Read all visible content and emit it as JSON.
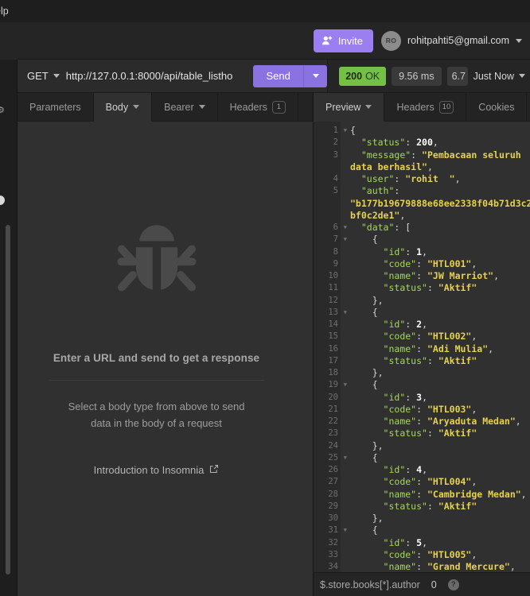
{
  "menubar": {
    "help_label": "elp"
  },
  "account_bar": {
    "invite_label": "Invite",
    "invite_icon": "user-plus-icon",
    "avatar_initials": "RO",
    "email": "rohitpahti5@gmail.com",
    "caret_icon": "chevron-down-icon",
    "accent_color": "#9b7ff0"
  },
  "request_bar": {
    "method": "GET",
    "method_caret_icon": "chevron-down-icon",
    "url": "http://127.0.0.1:8000/api/table_listho",
    "send_label": "Send",
    "send_caret_icon": "chevron-down-icon",
    "send_color": "#8a72e0"
  },
  "response_meta": {
    "status_code": "200",
    "status_text": "OK",
    "status_color": "#74c047",
    "time": "9.56 ms",
    "size": "6.7",
    "timestamp": "Just Now",
    "timestamp_caret_icon": "chevron-down-icon"
  },
  "request_tabs": [
    {
      "label": "Parameters",
      "active": false,
      "caret": false,
      "count": null
    },
    {
      "label": "Body",
      "active": true,
      "caret": true,
      "count": null
    },
    {
      "label": "Bearer",
      "active": false,
      "caret": true,
      "count": null
    },
    {
      "label": "Headers",
      "active": false,
      "caret": false,
      "count": "1"
    }
  ],
  "response_tabs": [
    {
      "label": "Preview",
      "active": true,
      "caret": true,
      "count": null
    },
    {
      "label": "Headers",
      "active": false,
      "caret": false,
      "count": "10"
    },
    {
      "label": "Cookies",
      "active": false,
      "caret": false,
      "count": null
    }
  ],
  "request_empty_state": {
    "icon": "bug-icon",
    "title": "Enter a URL and send to get a response",
    "subtitle": "Select a body type from above to send\ndata in the body of a request",
    "link_label": "Introduction to Insomnia",
    "link_icon": "external-link-icon"
  },
  "filter_bar": {
    "placeholder": "$.store.books[*].author",
    "count": "0",
    "help_icon": "question-mark-icon"
  },
  "response_body": {
    "lines": [
      {
        "num": "1",
        "fold": true,
        "html": "<span class=\"p\">{</span>"
      },
      {
        "num": "2",
        "fold": false,
        "html": "  <span class=\"k\">\"status\"</span><span class=\"p\">:</span> <span class=\"n\">200</span><span class=\"p\">,</span>"
      },
      {
        "num": "3",
        "fold": false,
        "html": "  <span class=\"k\">\"message\"</span><span class=\"p\">:</span> <span class=\"s\">\"Pembacaan seluruh</span>"
      },
      {
        "num": "",
        "fold": false,
        "html": "<span class=\"s\">data berhasil\"</span><span class=\"p\">,</span>"
      },
      {
        "num": "4",
        "fold": false,
        "html": "  <span class=\"k\">\"user\"</span><span class=\"p\">:</span> <span class=\"s\">\"rohit  \"</span><span class=\"p\">,</span>"
      },
      {
        "num": "5",
        "fold": false,
        "html": "  <span class=\"k\">\"auth\"</span><span class=\"p\">:</span>"
      },
      {
        "num": "",
        "fold": false,
        "html": "<span class=\"s\">\"b177b19679888e68ee2338f04b71d3c2</span>"
      },
      {
        "num": "",
        "fold": false,
        "html": "<span class=\"s\">bf0c2de1\"</span><span class=\"p\">,</span>"
      },
      {
        "num": "6",
        "fold": true,
        "html": "  <span class=\"k\">\"data\"</span><span class=\"p\">: [</span>"
      },
      {
        "num": "7",
        "fold": true,
        "html": "    <span class=\"p\">{</span>"
      },
      {
        "num": "8",
        "fold": false,
        "html": "      <span class=\"k\">\"id\"</span><span class=\"p\">:</span> <span class=\"n\">1</span><span class=\"p\">,</span>"
      },
      {
        "num": "9",
        "fold": false,
        "html": "      <span class=\"k\">\"code\"</span><span class=\"p\">:</span> <span class=\"s\">\"HTL001\"</span><span class=\"p\">,</span>"
      },
      {
        "num": "10",
        "fold": false,
        "html": "      <span class=\"k\">\"name\"</span><span class=\"p\">:</span> <span class=\"s\">\"JW Marriot\"</span><span class=\"p\">,</span>"
      },
      {
        "num": "11",
        "fold": false,
        "html": "      <span class=\"k\">\"status\"</span><span class=\"p\">:</span> <span class=\"s\">\"Aktif\"</span>"
      },
      {
        "num": "12",
        "fold": false,
        "html": "    <span class=\"p\">},</span>"
      },
      {
        "num": "13",
        "fold": true,
        "html": "    <span class=\"p\">{</span>"
      },
      {
        "num": "14",
        "fold": false,
        "html": "      <span class=\"k\">\"id\"</span><span class=\"p\">:</span> <span class=\"n\">2</span><span class=\"p\">,</span>"
      },
      {
        "num": "15",
        "fold": false,
        "html": "      <span class=\"k\">\"code\"</span><span class=\"p\">:</span> <span class=\"s\">\"HTL002\"</span><span class=\"p\">,</span>"
      },
      {
        "num": "16",
        "fold": false,
        "html": "      <span class=\"k\">\"name\"</span><span class=\"p\">:</span> <span class=\"s\">\"Adi Mulia\"</span><span class=\"p\">,</span>"
      },
      {
        "num": "17",
        "fold": false,
        "html": "      <span class=\"k\">\"status\"</span><span class=\"p\">:</span> <span class=\"s\">\"Aktif\"</span>"
      },
      {
        "num": "18",
        "fold": false,
        "html": "    <span class=\"p\">},</span>"
      },
      {
        "num": "19",
        "fold": true,
        "html": "    <span class=\"p\">{</span>"
      },
      {
        "num": "20",
        "fold": false,
        "html": "      <span class=\"k\">\"id\"</span><span class=\"p\">:</span> <span class=\"n\">3</span><span class=\"p\">,</span>"
      },
      {
        "num": "21",
        "fold": false,
        "html": "      <span class=\"k\">\"code\"</span><span class=\"p\">:</span> <span class=\"s\">\"HTL003\"</span><span class=\"p\">,</span>"
      },
      {
        "num": "22",
        "fold": false,
        "html": "      <span class=\"k\">\"name\"</span><span class=\"p\">:</span> <span class=\"s\">\"Aryaduta Medan\"</span><span class=\"p\">,</span>"
      },
      {
        "num": "23",
        "fold": false,
        "html": "      <span class=\"k\">\"status\"</span><span class=\"p\">:</span> <span class=\"s\">\"Aktif\"</span>"
      },
      {
        "num": "24",
        "fold": false,
        "html": "    <span class=\"p\">},</span>"
      },
      {
        "num": "25",
        "fold": true,
        "html": "    <span class=\"p\">{</span>"
      },
      {
        "num": "26",
        "fold": false,
        "html": "      <span class=\"k\">\"id\"</span><span class=\"p\">:</span> <span class=\"n\">4</span><span class=\"p\">,</span>"
      },
      {
        "num": "27",
        "fold": false,
        "html": "      <span class=\"k\">\"code\"</span><span class=\"p\">:</span> <span class=\"s\">\"HTL004\"</span><span class=\"p\">,</span>"
      },
      {
        "num": "28",
        "fold": false,
        "html": "      <span class=\"k\">\"name\"</span><span class=\"p\">:</span> <span class=\"s\">\"Cambridge Medan\"</span><span class=\"p\">,</span>"
      },
      {
        "num": "29",
        "fold": false,
        "html": "      <span class=\"k\">\"status\"</span><span class=\"p\">:</span> <span class=\"s\">\"Aktif\"</span>"
      },
      {
        "num": "30",
        "fold": false,
        "html": "    <span class=\"p\">},</span>"
      },
      {
        "num": "31",
        "fold": true,
        "html": "    <span class=\"p\">{</span>"
      },
      {
        "num": "32",
        "fold": false,
        "html": "      <span class=\"k\">\"id\"</span><span class=\"p\">:</span> <span class=\"n\">5</span><span class=\"p\">,</span>"
      },
      {
        "num": "33",
        "fold": false,
        "html": "      <span class=\"k\">\"code\"</span><span class=\"p\">:</span> <span class=\"s\">\"HTL005\"</span><span class=\"p\">,</span>"
      },
      {
        "num": "34",
        "fold": false,
        "html": "      <span class=\"k\">\"name\"</span><span class=\"p\">:</span> <span class=\"s\">\"Grand Mercure\"</span><span class=\"p\">,</span>"
      }
    ]
  }
}
